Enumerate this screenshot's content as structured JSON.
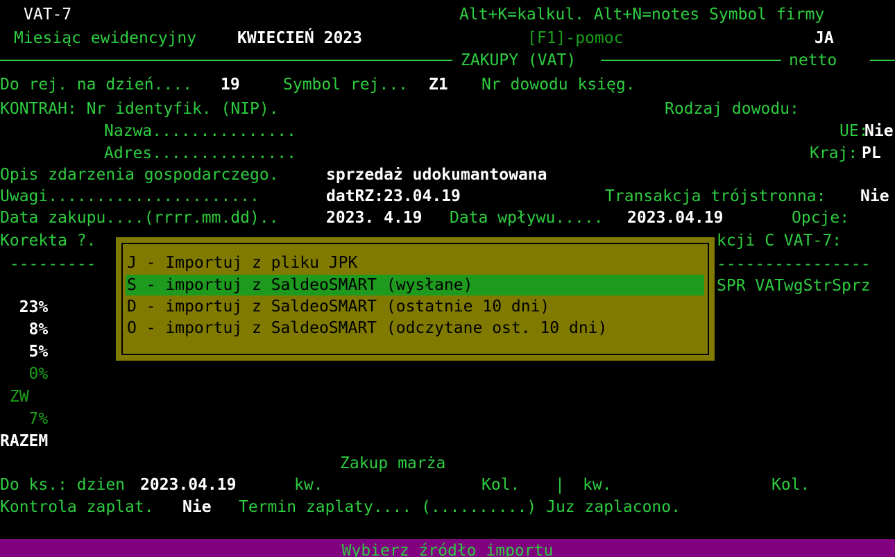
{
  "header": {
    "program": "VAT-7",
    "hotkeys": "Alt+K=kalkul. Alt+N=notes Symbol firmy",
    "month_label": "Miesiąc ewidencyjny",
    "month_value": "KWIECIEŃ 2023",
    "help": "[F1]-pomoc",
    "company_symbol": "JA",
    "section_title": "ZAKUPY (VAT)",
    "section_mode": "netto"
  },
  "form": {
    "reg_day_label": "Do rej. na dzień....",
    "reg_day_value": "19",
    "reg_symbol_label": "Symbol rej...",
    "reg_symbol_value": "Z1",
    "doc_no_label": "Nr dowodu księg.",
    "contractor_label": "KONTRAH: Nr identyfik. (NIP).",
    "doc_type_label": "Rodzaj dowodu:",
    "name_label": "Nazwa...............",
    "ue_label": "UE:",
    "ue_value": "Nie",
    "address_label": "Adres...............",
    "country_label": "Kraj:",
    "country_value": "PL",
    "description_label": "Opis zdarzenia gospodarczego.",
    "description_value": "sprzedaż udokumantowana",
    "notes_label": "Uwagi......................",
    "notes_value": "datRZ:23.04.19",
    "triangular_label": "Transakcja trójstronna:",
    "triangular_value": "Nie",
    "purchase_date_label": "Data zakupu....(rrrr.mm.dd)..",
    "purchase_date_value": "2023. 4.19",
    "receipt_date_label": "Data wpływu.....",
    "receipt_date_value": "2023.04.19",
    "options_label": "Opcje:",
    "correction_label": "Korekta ?.",
    "vat7_section_label": "kcji C VAT-7:",
    "dashes_left": " ---------",
    "dashes_right": "----------------",
    "column_header_right": "SPR VATwgStrSprz"
  },
  "rates": [
    {
      "label": "  23%",
      "style": "w"
    },
    {
      "label": "   8%",
      "style": "w"
    },
    {
      "label": "   5%",
      "style": "w"
    },
    {
      "label": "   0%",
      "style": "g2"
    },
    {
      "label": " ZW",
      "style": "g2"
    },
    {
      "label": "   7%",
      "style": "g2"
    },
    {
      "label": "RAZEM",
      "style": "w"
    }
  ],
  "footer": {
    "margin_purchase": "Zakup marża",
    "book_label": "Do ks.: dzien ",
    "book_date": "2023.04.19",
    "quarter1": "kw.",
    "col1": "Kol.",
    "sep": "|",
    "quarter2": "kw.",
    "col2": "Kol.",
    "payment_control_label": "Kontrola zaplat.",
    "payment_control_value": "Nie",
    "payment_due": "Termin zaplaty.... (..........) Juz zaplacono."
  },
  "popup": {
    "items": [
      {
        "text": "J - Importuj z pliku JPK",
        "selected": false
      },
      {
        "text": "S - importuj z SaldeoSMART (wysłane)",
        "selected": true
      },
      {
        "text": "D - importuj z SaldeoSMART (ostatnie 10 dni)",
        "selected": false
      },
      {
        "text": "O - importuj z SaldeoSMART (odczytane ost. 10 dni)",
        "selected": false
      }
    ]
  },
  "status_bar": "Wybierz źródło importu",
  "colors": {
    "background": "#000000",
    "text_green": "#2ecc40",
    "popup_bg": "#807b00",
    "selection": "#1e9a1e",
    "status_bg": "#800080"
  }
}
